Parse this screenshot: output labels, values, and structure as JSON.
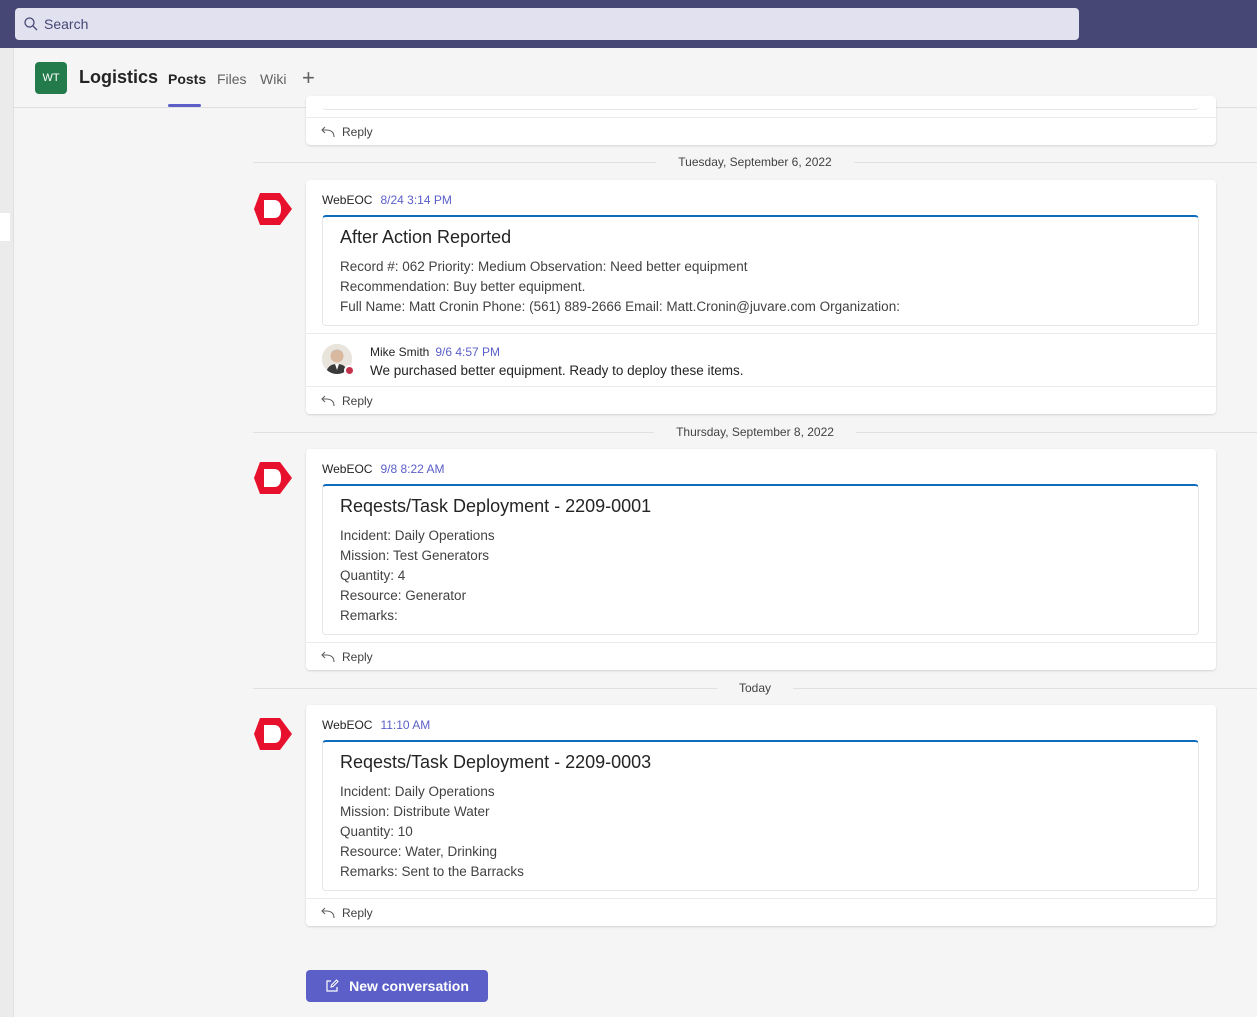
{
  "search": {
    "placeholder": "Search"
  },
  "team": {
    "initials": "WT",
    "name": "Logistics"
  },
  "tabs": [
    {
      "label": "Posts"
    },
    {
      "label": "Files"
    },
    {
      "label": "Wiki"
    }
  ],
  "reply_label": "Reply",
  "dates": {
    "d1": "Tuesday, September 6, 2022",
    "d2": "Thursday, September 8, 2022",
    "d3": "Today"
  },
  "posts": [
    {
      "author": "WebEOC",
      "time": "8/24 3:14 PM",
      "card_title": "After Action Reported",
      "lines": [
        "Record #: 062 Priority: Medium Observation: Need better equipment",
        "Recommendation: Buy better equipment.",
        "Full Name: Matt Cronin Phone: (561) 889-2666 Email: Matt.Cronin@juvare.com Organization:"
      ],
      "thread_reply": {
        "author": "Mike Smith",
        "time": "9/6 4:57 PM",
        "text": "We purchased better equipment. Ready to deploy these items."
      }
    },
    {
      "author": "WebEOC",
      "time": "9/8 8:22 AM",
      "card_title": "Reqests/Task Deployment - 2209-0001",
      "lines": [
        "Incident: Daily Operations",
        "Mission: Test Generators",
        "Quantity: 4",
        "Resource: Generator",
        "Remarks:"
      ]
    },
    {
      "author": "WebEOC",
      "time": "11:10 AM",
      "card_title": "Reqests/Task Deployment - 2209-0003",
      "lines": [
        "Incident: Daily Operations",
        "Mission: Distribute Water",
        "Quantity: 10",
        "Resource: Water, Drinking",
        "Remarks: Sent to the Barracks"
      ]
    }
  ],
  "new_conversation_label": "New conversation",
  "colors": {
    "topbar": "#464775",
    "accent": "#5b5fc7",
    "team_avatar": "#237b4b",
    "card_accent": "#0f6cbd",
    "bot_logo": "#e8112d"
  }
}
